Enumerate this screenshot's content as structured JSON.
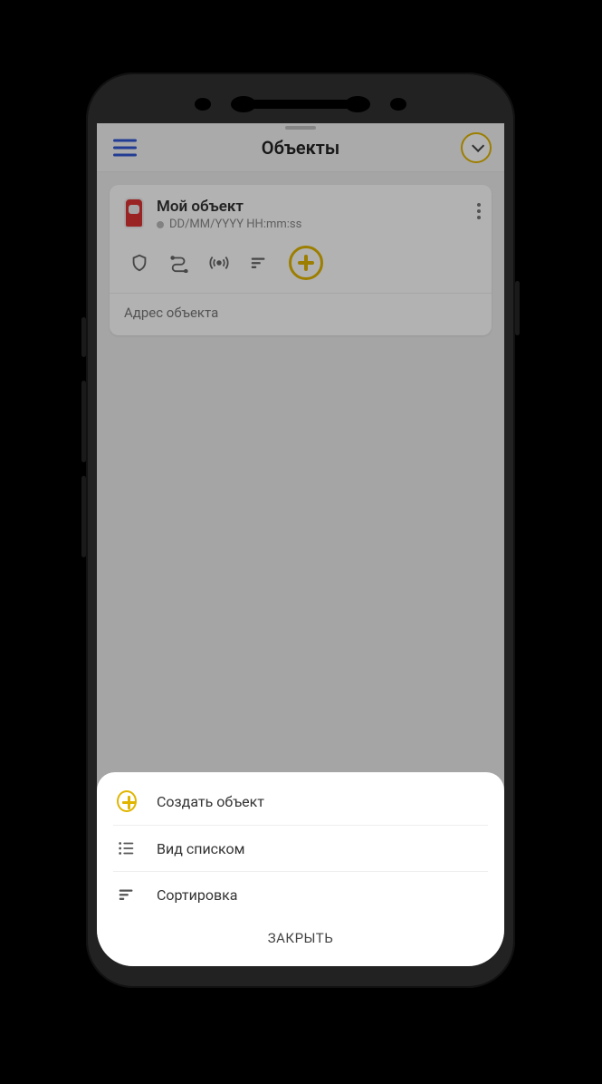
{
  "header": {
    "title": "Объекты"
  },
  "card": {
    "title": "Мой объект",
    "timestamp": "DD/MM/YYYY HH:mm:ss",
    "address": "Адрес объекта"
  },
  "sheet": {
    "items": [
      {
        "label": "Создать объект"
      },
      {
        "label": "Вид списком"
      },
      {
        "label": "Сортировка"
      }
    ],
    "close": "ЗАКРЫТЬ"
  }
}
